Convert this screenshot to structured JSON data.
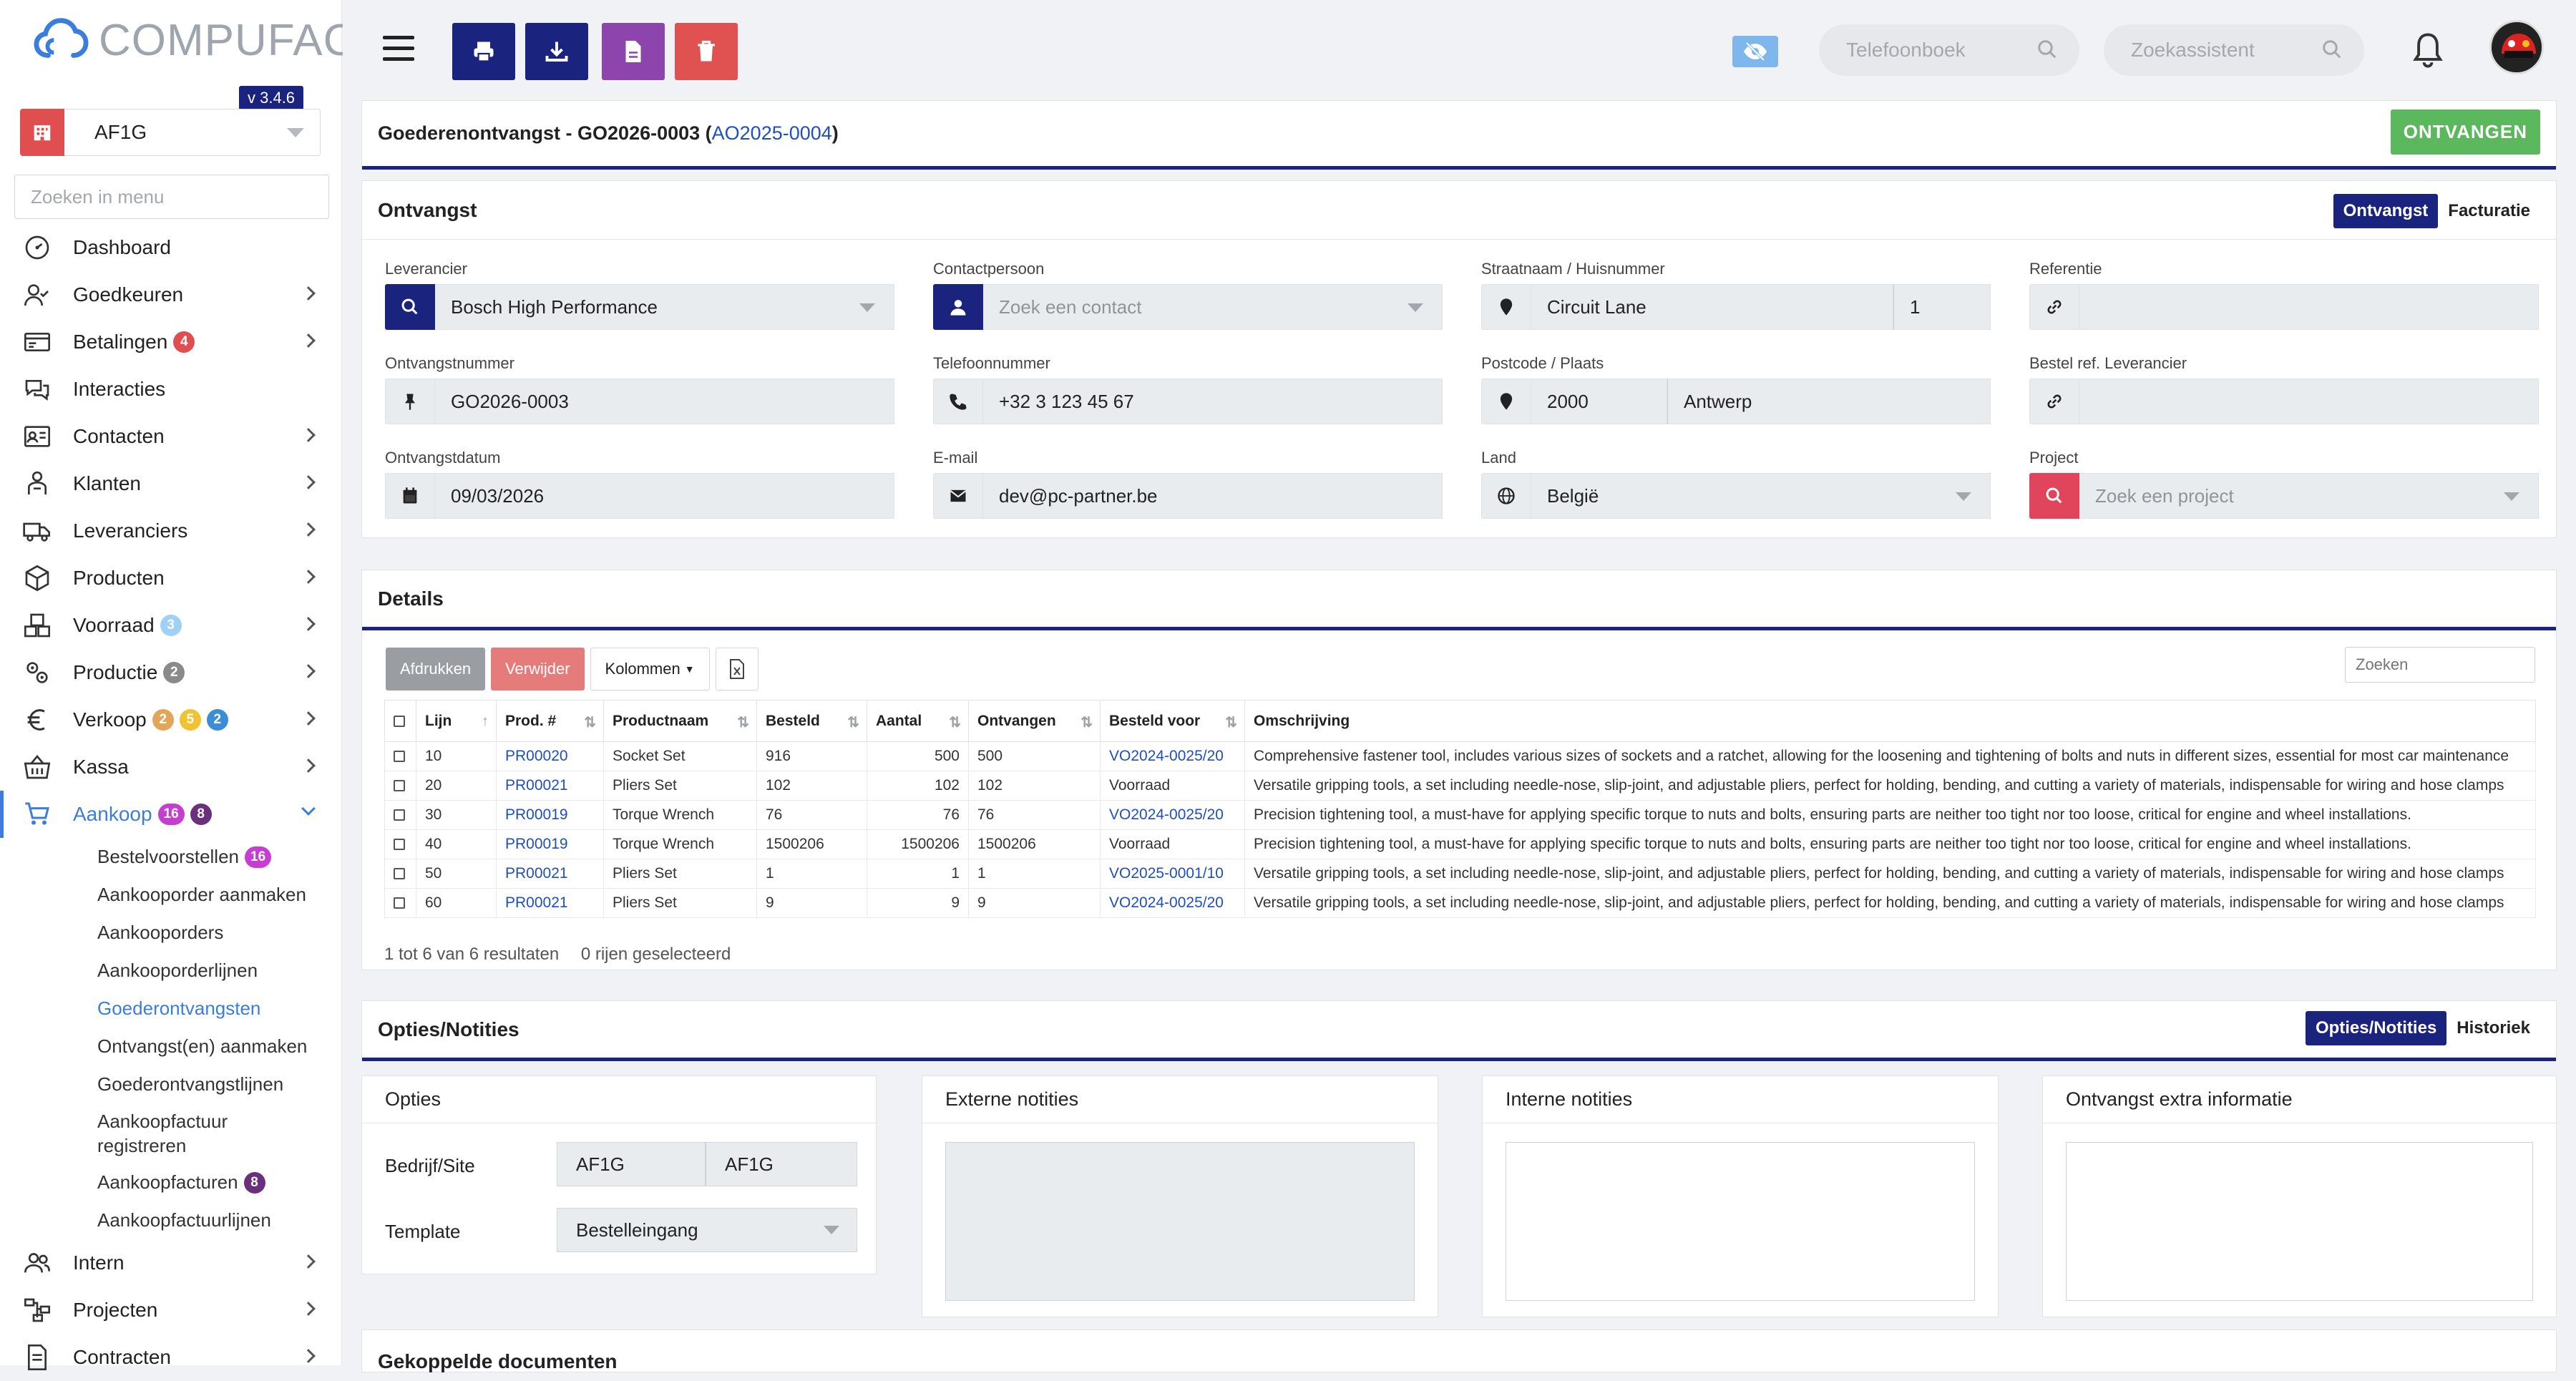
{
  "app": {
    "brand": "COMPUFACT",
    "version": "v 3.4.6"
  },
  "sidebar": {
    "company": "AF1G",
    "search_placeholder": "Zoeken in menu",
    "items": [
      {
        "label": "Dashboard",
        "icon": "dashboard-icon",
        "chevron": false,
        "badges": []
      },
      {
        "label": "Goedkeuren",
        "icon": "user-check-icon",
        "chevron": true,
        "badges": []
      },
      {
        "label": "Betalingen",
        "icon": "payments-icon",
        "chevron": true,
        "badges": [
          {
            "t": "4",
            "c": "b-red"
          }
        ]
      },
      {
        "label": "Interacties",
        "icon": "chat-icon",
        "chevron": false,
        "badges": []
      },
      {
        "label": "Contacten",
        "icon": "contact-card-icon",
        "chevron": true,
        "badges": []
      },
      {
        "label": "Klanten",
        "icon": "customer-icon",
        "chevron": true,
        "badges": []
      },
      {
        "label": "Leveranciers",
        "icon": "truck-icon",
        "chevron": true,
        "badges": []
      },
      {
        "label": "Producten",
        "icon": "box-icon",
        "chevron": true,
        "badges": []
      },
      {
        "label": "Voorraad",
        "icon": "boxes-icon",
        "chevron": true,
        "badges": [
          {
            "t": "3",
            "c": "b-lightblue"
          }
        ]
      },
      {
        "label": "Productie",
        "icon": "gears-icon",
        "chevron": true,
        "badges": [
          {
            "t": "2",
            "c": "b-grey"
          }
        ]
      },
      {
        "label": "Verkoop",
        "icon": "euro-icon",
        "chevron": true,
        "badges": [
          {
            "t": "2",
            "c": "b-orange"
          },
          {
            "t": "5",
            "c": "b-yellow"
          },
          {
            "t": "2",
            "c": "b-blue"
          }
        ]
      },
      {
        "label": "Kassa",
        "icon": "basket-icon",
        "chevron": true,
        "badges": []
      },
      {
        "label": "Aankoop",
        "icon": "cart-icon",
        "chevron": true,
        "open": true,
        "badges": [
          {
            "t": "16",
            "c": "b-mag"
          },
          {
            "t": "8",
            "c": "b-purple"
          }
        ]
      }
    ],
    "subitems": [
      {
        "label": "Bestelvoorstellen",
        "badge": "16",
        "bc": "b-mag"
      },
      {
        "label": "Aankooporder aanmaken"
      },
      {
        "label": "Aankooporders"
      },
      {
        "label": "Aankooporderlijnen"
      },
      {
        "label": "Goederontvangsten",
        "active": true
      },
      {
        "label": "Ontvangst(en) aanmaken"
      },
      {
        "label": "Goederontvangstlijnen"
      },
      {
        "label": "Aankoopfactuur registreren",
        "two": true
      },
      {
        "label": "Aankoopfacturen",
        "badge": "8",
        "bc": "b-purple"
      },
      {
        "label": "Aankoopfactuurlijnen"
      }
    ],
    "items_after": [
      {
        "label": "Intern",
        "icon": "users-icon",
        "chevron": true,
        "badges": []
      },
      {
        "label": "Projecten",
        "icon": "project-icon",
        "chevron": true,
        "badges": []
      },
      {
        "label": "Contracten",
        "icon": "contract-icon",
        "chevron": true,
        "badges": []
      }
    ]
  },
  "topbar": {
    "phonebook_placeholder": "Telefoonboek",
    "assistant_placeholder": "Zoekassistent",
    "colors": {
      "print": "#1a237e",
      "download": "#1a237e",
      "document": "#8e44ad",
      "delete": "#e05252"
    }
  },
  "header": {
    "title": "Goederenontvangst - GO2026-0003 (",
    "link": "AO2025-0004",
    "title_end": ")",
    "action": "ONTVANGEN"
  },
  "ontvangst": {
    "title": "Ontvangst",
    "tabs": [
      "Ontvangst",
      "Facturatie"
    ],
    "fields": {
      "leverancier": {
        "label": "Leverancier",
        "value": "Bosch High Performance"
      },
      "contact": {
        "label": "Contactpersoon",
        "placeholder": "Zoek een contact"
      },
      "straat": {
        "label": "Straatnaam / Huisnummer",
        "value": "Circuit Lane",
        "nr": "1"
      },
      "referentie": {
        "label": "Referentie",
        "value": ""
      },
      "ontvangstnummer": {
        "label": "Ontvangstnummer",
        "value": "GO2026-0003"
      },
      "telefoon": {
        "label": "Telefoonnummer",
        "value": "+32 3 123 45 67"
      },
      "postcode": {
        "label": "Postcode / Plaats",
        "value": "2000",
        "plaats": "Antwerp"
      },
      "bestelref": {
        "label": "Bestel ref. Leverancier",
        "value": ""
      },
      "datum": {
        "label": "Ontvangstdatum",
        "value": "09/03/2026"
      },
      "email": {
        "label": "E-mail",
        "value": "dev@pc-partner.be"
      },
      "land": {
        "label": "Land",
        "value": "België"
      },
      "project": {
        "label": "Project",
        "placeholder": "Zoek een project"
      }
    }
  },
  "details": {
    "title": "Details",
    "buttons": {
      "print": "Afdrukken",
      "delete": "Verwijder",
      "columns": "Kolommen"
    },
    "search_placeholder": "Zoeken",
    "columns": [
      "Lijn",
      "Prod. #",
      "Productnaam",
      "Besteld",
      "Aantal",
      "Ontvangen",
      "Besteld voor",
      "Omschrijving"
    ],
    "rows": [
      [
        "10",
        "PR00020",
        "Socket Set",
        "916",
        "500",
        "500",
        "VO2024-0025/20",
        "Comprehensive fastener tool, includes various sizes of sockets and a ratchet, allowing for the loosening and tightening of bolts and nuts in different sizes, essential for most car maintenance"
      ],
      [
        "20",
        "PR00021",
        "Pliers Set",
        "102",
        "102",
        "102",
        "Voorraad",
        "Versatile gripping tools, a set including needle-nose, slip-joint, and adjustable pliers, perfect for holding, bending, and cutting a variety of materials, indispensable for wiring and hose clamps"
      ],
      [
        "30",
        "PR00019",
        "Torque Wrench",
        "76",
        "76",
        "76",
        "VO2024-0025/20",
        "Precision tightening tool, a must-have for applying specific torque to nuts and bolts, ensuring parts are neither too tight nor too loose, critical for engine and wheel installations."
      ],
      [
        "40",
        "PR00019",
        "Torque Wrench",
        "1500206",
        "1500206",
        "1500206",
        "Voorraad",
        "Precision tightening tool, a must-have for applying specific torque to nuts and bolts, ensuring parts are neither too tight nor too loose, critical for engine and wheel installations."
      ],
      [
        "50",
        "PR00021",
        "Pliers Set",
        "1",
        "1",
        "1",
        "VO2025-0001/10",
        "Versatile gripping tools, a set including needle-nose, slip-joint, and adjustable pliers, perfect for holding, bending, and cutting a variety of materials, indispensable for wiring and hose clamps"
      ],
      [
        "60",
        "PR00021",
        "Pliers Set",
        "9",
        "9",
        "9",
        "VO2024-0025/20",
        "Versatile gripping tools, a set including needle-nose, slip-joint, and adjustable pliers, perfect for holding, bending, and cutting a variety of materials, indispensable for wiring and hose clamps"
      ]
    ],
    "footer_results": "1 tot 6 van 6 resultaten",
    "footer_selected": "0 rijen geselecteerd"
  },
  "opties": {
    "title": "Opties/Notities",
    "tabs": [
      "Opties/Notities",
      "Historiek"
    ],
    "opties_title": "Opties",
    "bedrijf_label": "Bedrijf/Site",
    "bedrijf_value": "AF1G",
    "site_value": "AF1G",
    "template_label": "Template",
    "template_value": "Bestelleingang",
    "externe": "Externe notities",
    "interne": "Interne notities",
    "extra": "Ontvangst extra informatie"
  },
  "gekoppeld": {
    "title": "Gekoppelde documenten"
  }
}
